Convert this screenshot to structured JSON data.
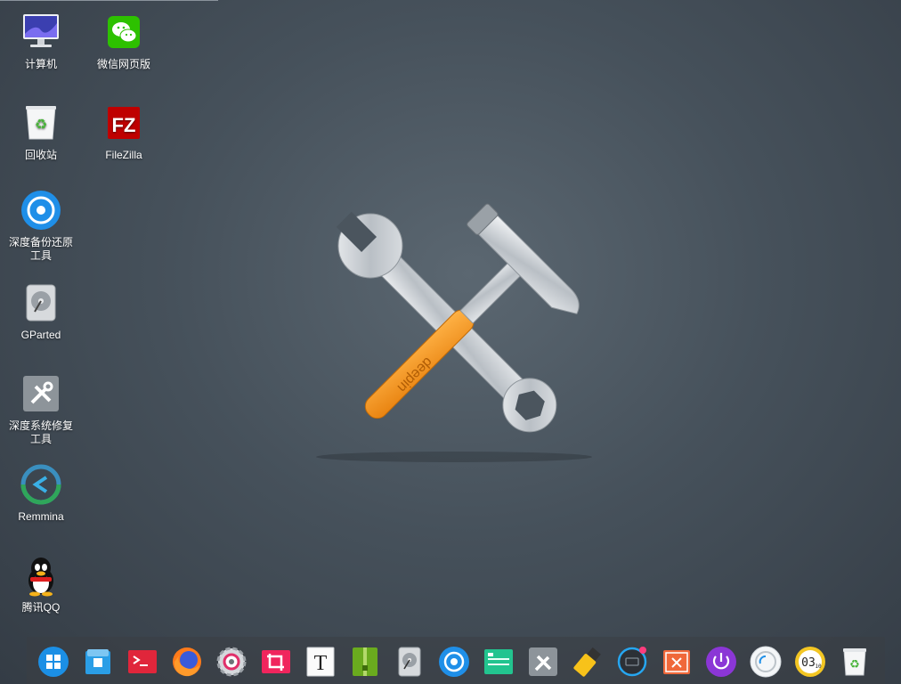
{
  "desktop": {
    "icons": [
      {
        "label": "计算机",
        "icon": "computer-icon"
      },
      {
        "label": "微信网页版",
        "icon": "wechat-icon"
      },
      {
        "label": "回收站",
        "icon": "trash-icon"
      },
      {
        "label": "FileZilla",
        "icon": "filezilla-icon"
      },
      {
        "label": "深度备份还原工具",
        "icon": "backup-restore-icon"
      },
      {
        "label": "GParted",
        "icon": "gparted-icon"
      },
      {
        "label": "深度系统修复工具",
        "icon": "system-repair-icon"
      },
      {
        "label": "Remmina",
        "icon": "remmina-icon"
      },
      {
        "label": "腾讯QQ",
        "icon": "qq-icon"
      }
    ],
    "wallpaper_logo_text": "deepin"
  },
  "dock": {
    "items": [
      {
        "name": "launcher",
        "icon": "launcher-icon"
      },
      {
        "name": "file-manager",
        "icon": "file-manager-icon"
      },
      {
        "name": "terminal",
        "icon": "terminal-icon"
      },
      {
        "name": "firefox",
        "icon": "firefox-icon"
      },
      {
        "name": "settings",
        "icon": "settings-icon"
      },
      {
        "name": "screenshot",
        "icon": "screenshot-icon"
      },
      {
        "name": "text-editor",
        "icon": "text-editor-icon",
        "glyph": "T"
      },
      {
        "name": "archive-manager",
        "icon": "archive-icon"
      },
      {
        "name": "disk-utility",
        "icon": "disk-icon"
      },
      {
        "name": "backup-restore",
        "icon": "backup-restore-icon"
      },
      {
        "name": "system-monitor",
        "icon": "system-monitor-icon"
      },
      {
        "name": "repair-tool",
        "icon": "repair-tool-icon"
      },
      {
        "name": "usb-writer",
        "icon": "usb-icon"
      },
      {
        "name": "onscreen-keyboard",
        "icon": "keyboard-icon"
      },
      {
        "name": "close-app",
        "icon": "close-app-icon"
      },
      {
        "name": "power",
        "icon": "power-icon"
      },
      {
        "name": "notifications",
        "icon": "notification-icon"
      },
      {
        "name": "clock",
        "icon": "clock-icon",
        "text": "03",
        "sub": "10"
      },
      {
        "name": "trash",
        "icon": "trash-icon"
      }
    ]
  }
}
